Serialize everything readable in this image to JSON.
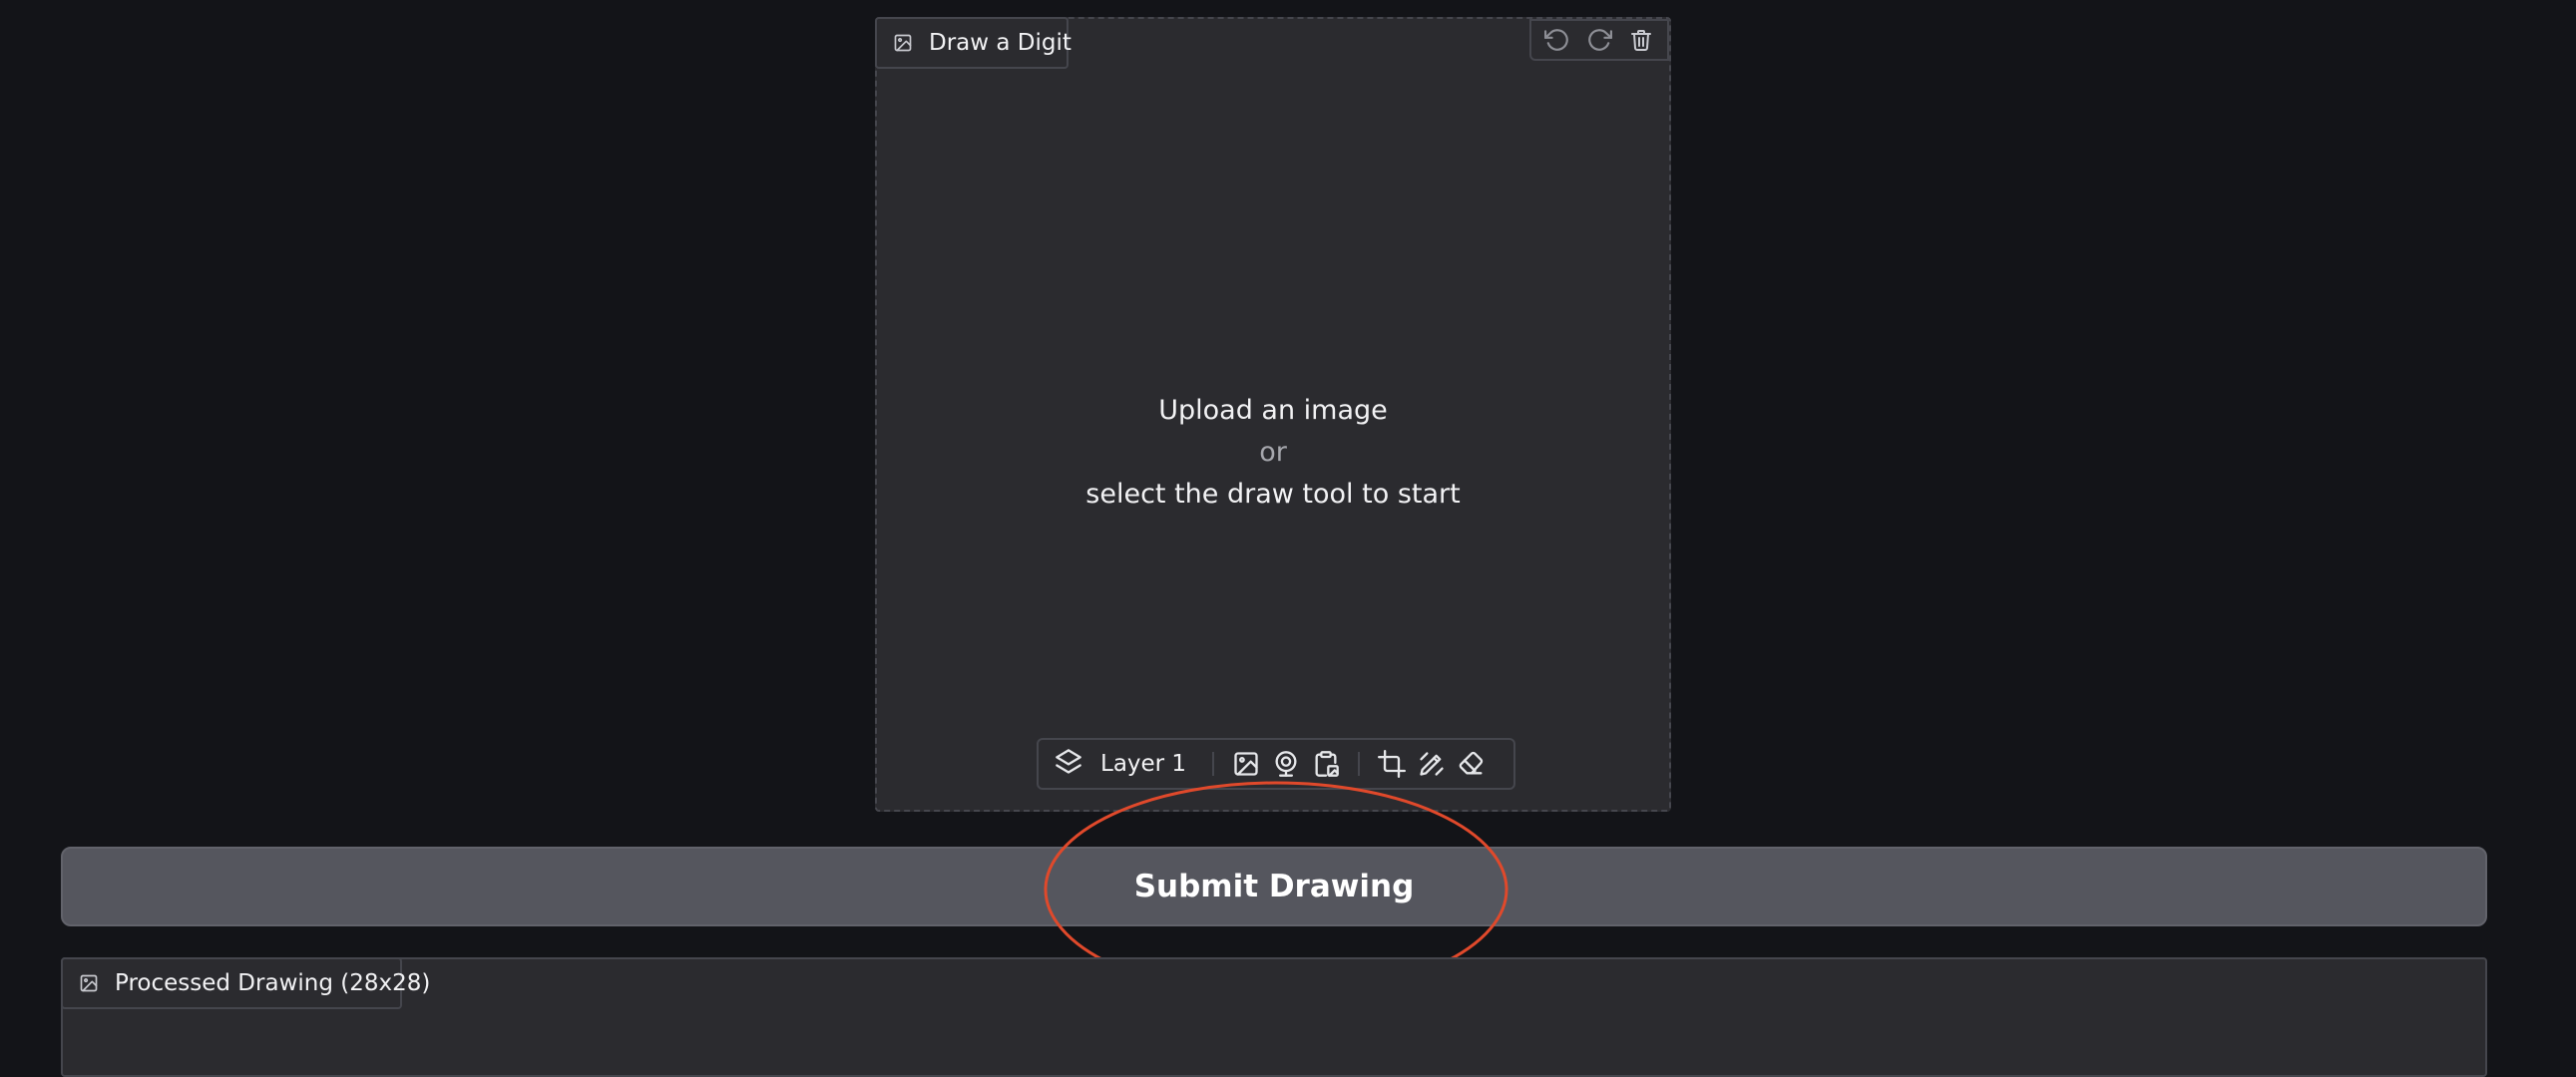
{
  "editor": {
    "label": "Draw a Digit",
    "label_icon": "image-icon",
    "history_tools": [
      {
        "name": "undo-icon"
      },
      {
        "name": "redo-icon"
      },
      {
        "name": "trash-icon"
      }
    ],
    "placeholder": {
      "line1": "Upload an image",
      "line2": "or",
      "line3": "select the draw tool to start"
    },
    "toolbar": {
      "layer_icon": "layers-icon",
      "layer_label": "Layer 1",
      "source_tools": [
        {
          "name": "upload-image-icon"
        },
        {
          "name": "webcam-icon"
        },
        {
          "name": "paste-clipboard-icon"
        }
      ],
      "edit_tools": [
        {
          "name": "crop-icon"
        },
        {
          "name": "brush-icon"
        },
        {
          "name": "eraser-icon"
        }
      ]
    }
  },
  "submit": {
    "label": "Submit Drawing",
    "highlight_color": "#e0492b"
  },
  "output": {
    "label": "Processed Drawing (28x28)",
    "label_icon": "image-icon"
  },
  "colors": {
    "background": "#131418",
    "panel": "#2b2b2f",
    "border": "#45464d",
    "button": "#55565e",
    "text": "#f2f2f4"
  }
}
